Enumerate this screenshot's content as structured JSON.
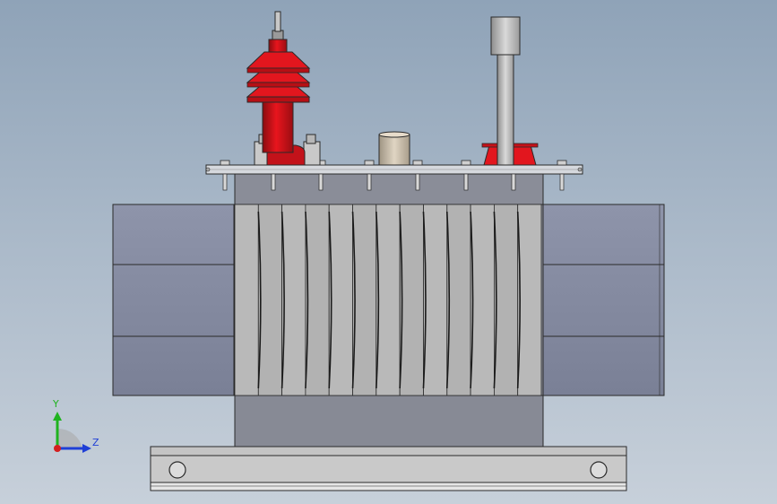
{
  "viewport": {
    "triad": {
      "y_label": "Y",
      "z_label": "Z",
      "colors": {
        "y": "#1fb31f",
        "z": "#1f3fd6",
        "origin": "#d41f1f"
      }
    }
  },
  "model": {
    "name": "transformer",
    "colors": {
      "bushing_red": "#e0141c",
      "bushing_red_dark": "#a40e12",
      "tank": "#8f929b",
      "tank_dark": "#6f727c",
      "fin": "#b8b8b8",
      "side_radiator": "#848aa0",
      "lid": "#d6d9de",
      "base_rail": "#c8c8c8",
      "cap": "#cfc2ad",
      "grey_bushing": "#c8c8c8"
    }
  }
}
